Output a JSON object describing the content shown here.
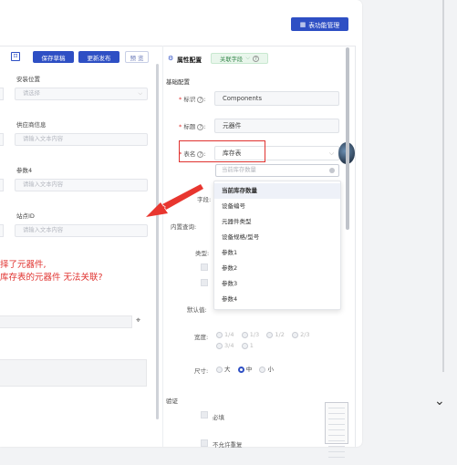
{
  "header": {
    "func_mgmt_button": "表功能管理",
    "func_mgmt_icon": "grid-icon"
  },
  "toolbar": {
    "save_draft": "保存草稿",
    "update_publish": "更新发布",
    "preview": "预 览"
  },
  "left_form": {
    "fields": [
      {
        "label": "安装位置",
        "placeholder": "请选择"
      },
      {
        "label": "供应商信息",
        "placeholder": "请输入文本内容"
      },
      {
        "label": "参数4",
        "placeholder": "请输入文本内容"
      },
      {
        "label": "站点ID",
        "placeholder": "请输入文本内容"
      }
    ],
    "annotation_line1": "择了元器件,",
    "annotation_line2": "库存表的元器件 无法关联?"
  },
  "panel": {
    "title": "属性配置",
    "tab_label": "关联字段",
    "section_basic": "基础配置",
    "props": {
      "id_label": "标识",
      "id_value": "Components",
      "title_label": "标题",
      "title_value": "元器件",
      "table_label": "表名",
      "table_value": "库存表",
      "search_placeholder": "当前库存数量",
      "field_label": "字段:",
      "builtin_query_label": "内置查询:",
      "type_label": "类型:",
      "default_label": "默认值:",
      "width_label": "宽度:",
      "size_label": "尺寸:"
    },
    "dropdown_items": [
      "当前库存数量",
      "设备编号",
      "元器件类型",
      "设备规格/型号",
      "参数1",
      "参数2",
      "参数3",
      "参数4"
    ],
    "width_options": [
      "1/4",
      "1/3",
      "1/2",
      "2/3",
      "3/4",
      "1"
    ],
    "size_options": [
      "大",
      "中",
      "小"
    ],
    "size_selected": "中",
    "section_validate": "验证",
    "required_label": "必填",
    "unique_label": "不允许重复"
  },
  "colors": {
    "primary": "#2e4fc4",
    "accent_red": "#e0322f",
    "tab_green": "#3b8a50"
  }
}
